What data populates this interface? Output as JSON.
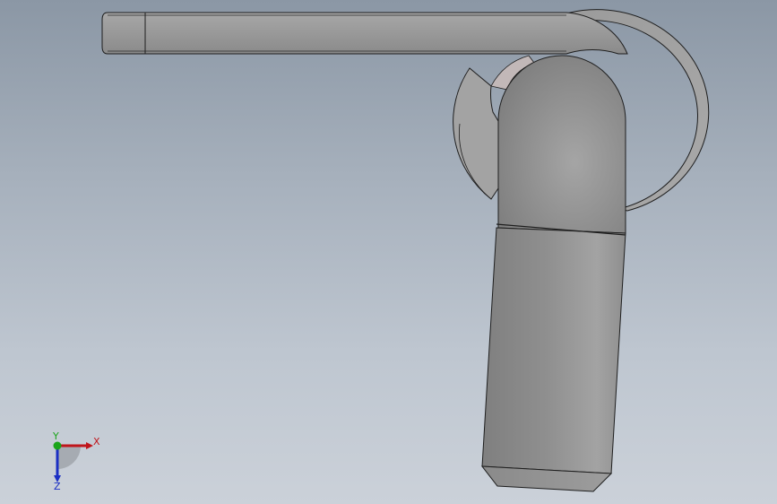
{
  "colors": {
    "background_top": "#8b97a5",
    "background_bottom": "#cbd1d9",
    "part_light": "#b5b5b5",
    "part_mid": "#9a9a9a",
    "part_dark": "#7c7c7c",
    "edge": "#1e1e1e",
    "axis_x": "#c0151b",
    "axis_y": "#1aa41a",
    "axis_z": "#1b2fc4"
  },
  "triad": {
    "x_label": "X",
    "y_label": "Y",
    "z_label": "Z"
  }
}
